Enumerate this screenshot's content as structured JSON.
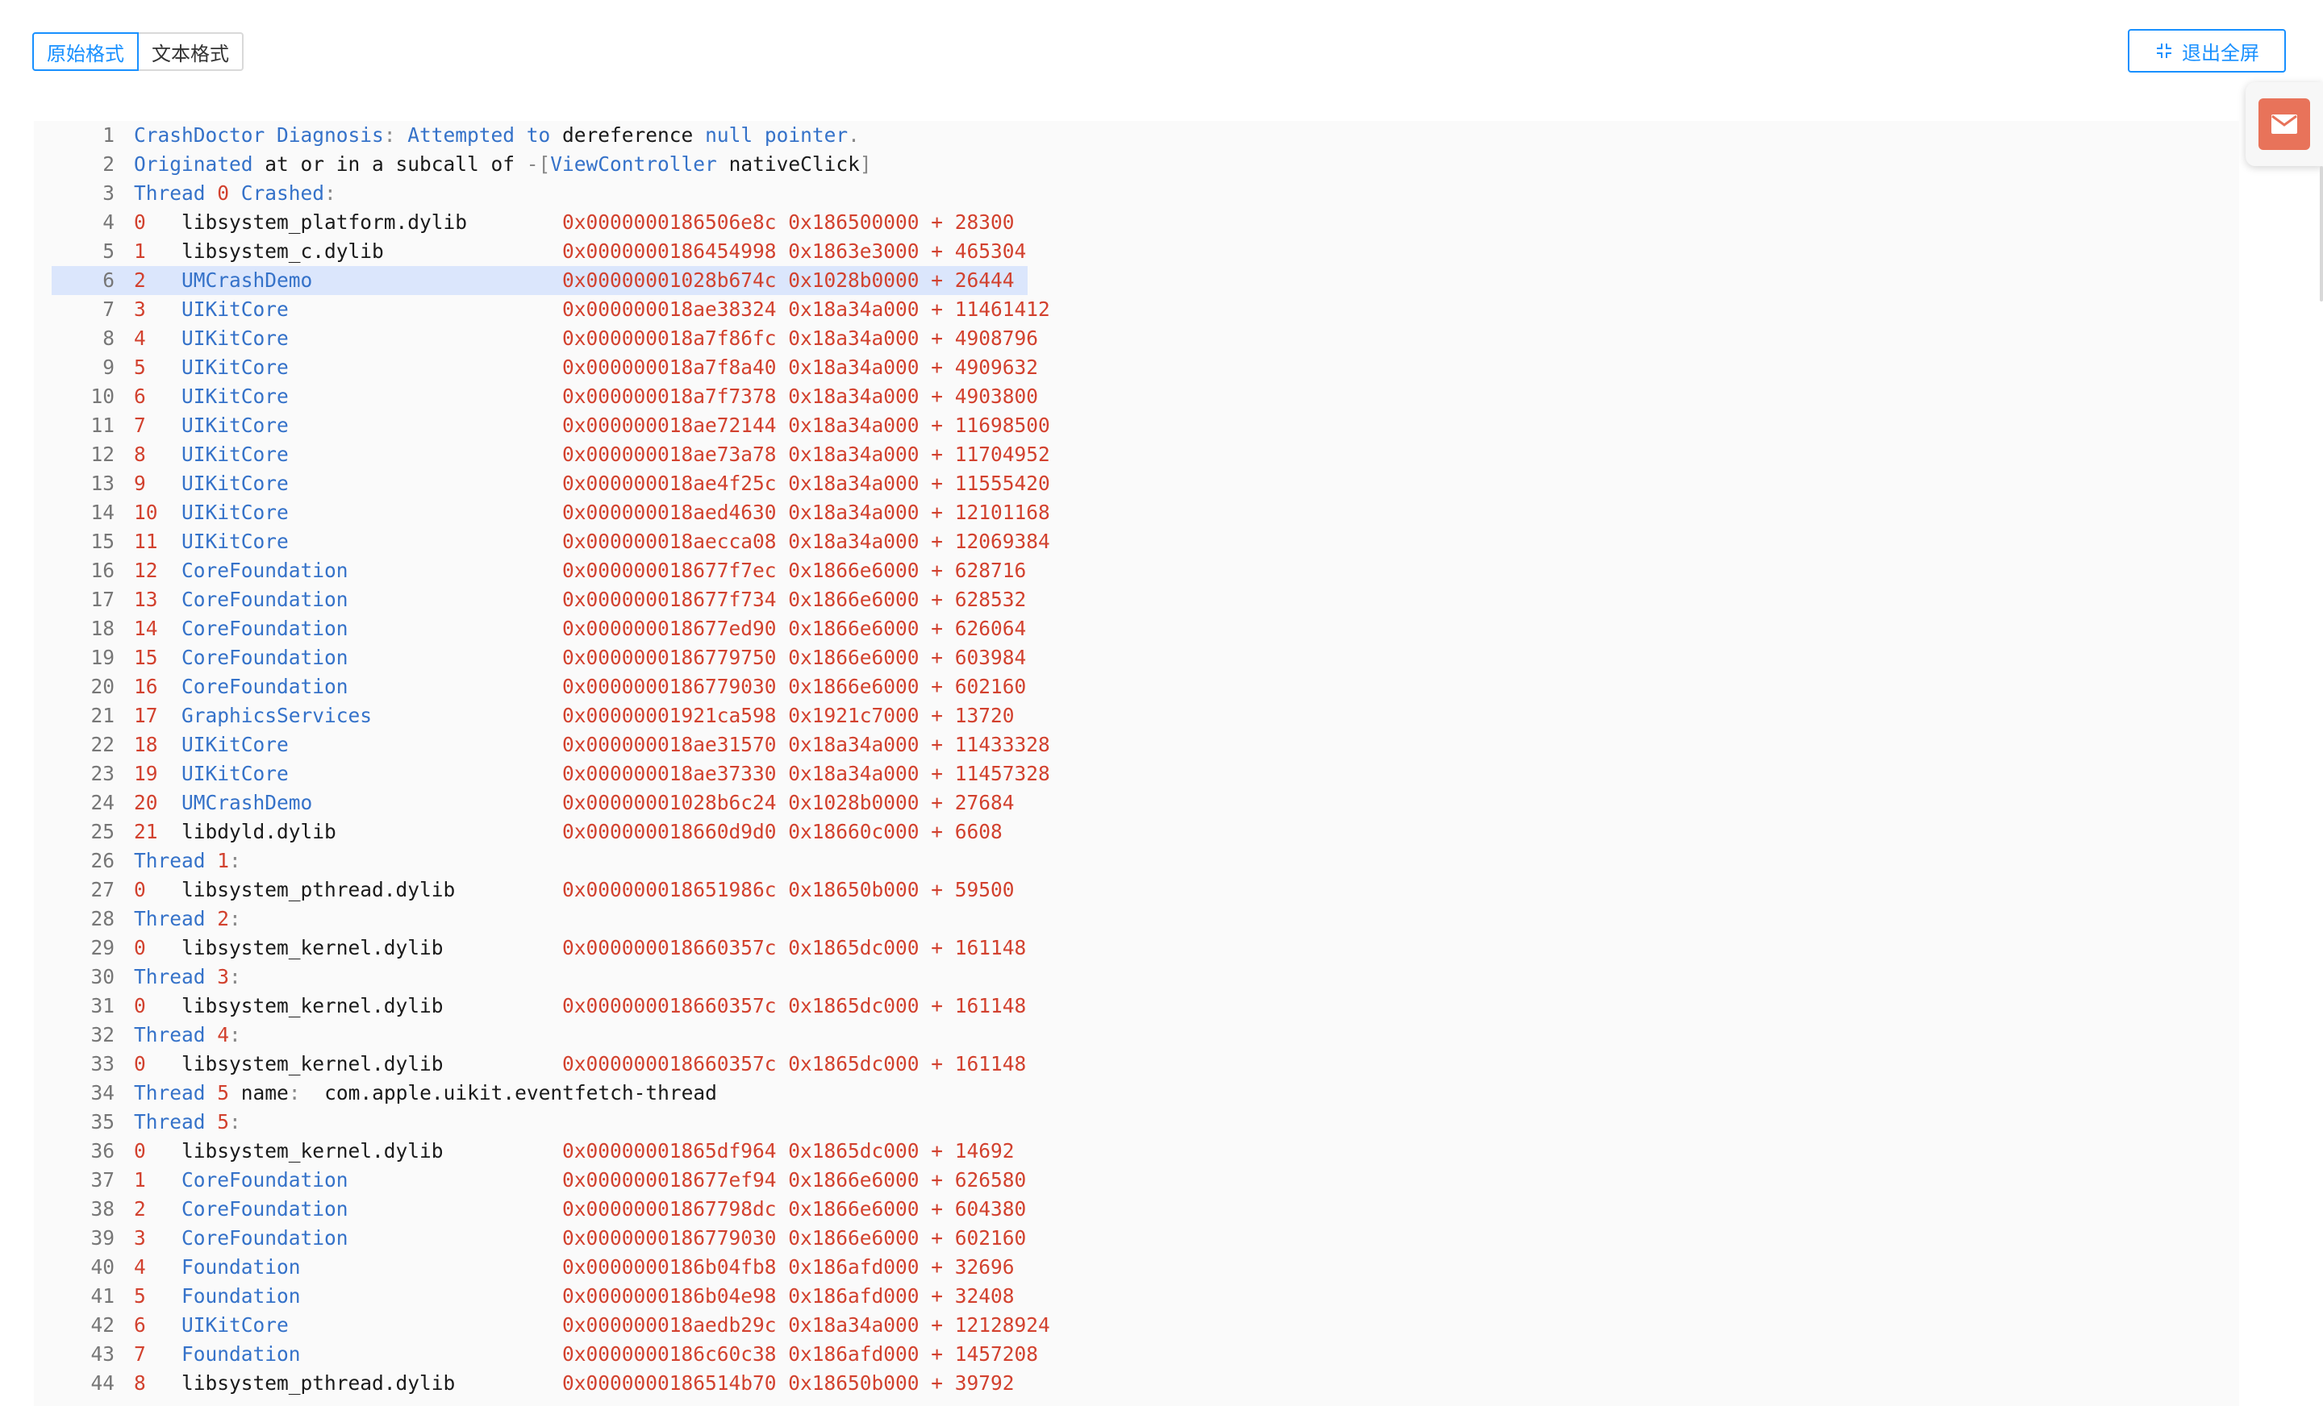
{
  "toolbar": {
    "raw_format_label": "原始格式",
    "text_format_label": "文本格式",
    "exit_fullscreen_label": "退出全屏"
  },
  "colors": {
    "accent": "#1890ff",
    "keyword": "#3572c9",
    "number": "#d2412e",
    "highlight": "#dbe6fc",
    "mail": "#e8735a"
  },
  "icons": {
    "exit": "exit-fullscreen-icon",
    "mail": "mail-icon"
  },
  "highlighted_line": 6,
  "lines": [
    {
      "n": "1",
      "tokens": [
        [
          "k",
          "CrashDoctor Diagnosis"
        ],
        [
          "p",
          ": "
        ],
        [
          "k",
          "Attempted to "
        ],
        [
          "t",
          "dereference "
        ],
        [
          "k",
          "null pointer"
        ],
        [
          "p",
          "."
        ]
      ]
    },
    {
      "n": "2",
      "tokens": [
        [
          "k",
          "Originated "
        ],
        [
          "t",
          "at or in a subcall of "
        ],
        [
          "p",
          "-["
        ],
        [
          "k",
          "ViewController "
        ],
        [
          "t",
          "nativeClick"
        ],
        [
          "p",
          "]"
        ]
      ]
    },
    {
      "n": "3",
      "tokens": [
        [
          "k",
          "Thread "
        ],
        [
          "r",
          "0 "
        ],
        [
          "k",
          "Crashed"
        ],
        [
          "p",
          ":"
        ]
      ]
    },
    {
      "n": "4",
      "tokens": [
        [
          "r",
          "0   "
        ],
        [
          "t",
          "libsystem_platform.dylib        "
        ],
        [
          "r",
          "0x0000000186506e8c 0x186500000 + 28300"
        ]
      ]
    },
    {
      "n": "5",
      "tokens": [
        [
          "r",
          "1   "
        ],
        [
          "t",
          "libsystem_c.dylib               "
        ],
        [
          "r",
          "0x0000000186454998 0x1863e3000 + 465304"
        ]
      ]
    },
    {
      "n": "6",
      "tokens": [
        [
          "r",
          "2   "
        ],
        [
          "k",
          "UMCrashDemo                     "
        ],
        [
          "r",
          "0x00000001028b674c 0x1028b0000 + 26444"
        ]
      ]
    },
    {
      "n": "7",
      "tokens": [
        [
          "r",
          "3   "
        ],
        [
          "k",
          "UIKitCore                       "
        ],
        [
          "r",
          "0x000000018ae38324 0x18a34a000 + 11461412"
        ]
      ]
    },
    {
      "n": "8",
      "tokens": [
        [
          "r",
          "4   "
        ],
        [
          "k",
          "UIKitCore                       "
        ],
        [
          "r",
          "0x000000018a7f86fc 0x18a34a000 + 4908796"
        ]
      ]
    },
    {
      "n": "9",
      "tokens": [
        [
          "r",
          "5   "
        ],
        [
          "k",
          "UIKitCore                       "
        ],
        [
          "r",
          "0x000000018a7f8a40 0x18a34a000 + 4909632"
        ]
      ]
    },
    {
      "n": "10",
      "tokens": [
        [
          "r",
          "6   "
        ],
        [
          "k",
          "UIKitCore                       "
        ],
        [
          "r",
          "0x000000018a7f7378 0x18a34a000 + 4903800"
        ]
      ]
    },
    {
      "n": "11",
      "tokens": [
        [
          "r",
          "7   "
        ],
        [
          "k",
          "UIKitCore                       "
        ],
        [
          "r",
          "0x000000018ae72144 0x18a34a000 + 11698500"
        ]
      ]
    },
    {
      "n": "12",
      "tokens": [
        [
          "r",
          "8   "
        ],
        [
          "k",
          "UIKitCore                       "
        ],
        [
          "r",
          "0x000000018ae73a78 0x18a34a000 + 11704952"
        ]
      ]
    },
    {
      "n": "13",
      "tokens": [
        [
          "r",
          "9   "
        ],
        [
          "k",
          "UIKitCore                       "
        ],
        [
          "r",
          "0x000000018ae4f25c 0x18a34a000 + 11555420"
        ]
      ]
    },
    {
      "n": "14",
      "tokens": [
        [
          "r",
          "10  "
        ],
        [
          "k",
          "UIKitCore                       "
        ],
        [
          "r",
          "0x000000018aed4630 0x18a34a000 + 12101168"
        ]
      ]
    },
    {
      "n": "15",
      "tokens": [
        [
          "r",
          "11  "
        ],
        [
          "k",
          "UIKitCore                       "
        ],
        [
          "r",
          "0x000000018aecca08 0x18a34a000 + 12069384"
        ]
      ]
    },
    {
      "n": "16",
      "tokens": [
        [
          "r",
          "12  "
        ],
        [
          "k",
          "CoreFoundation                  "
        ],
        [
          "r",
          "0x000000018677f7ec 0x1866e6000 + 628716"
        ]
      ]
    },
    {
      "n": "17",
      "tokens": [
        [
          "r",
          "13  "
        ],
        [
          "k",
          "CoreFoundation                  "
        ],
        [
          "r",
          "0x000000018677f734 0x1866e6000 + 628532"
        ]
      ]
    },
    {
      "n": "18",
      "tokens": [
        [
          "r",
          "14  "
        ],
        [
          "k",
          "CoreFoundation                  "
        ],
        [
          "r",
          "0x000000018677ed90 0x1866e6000 + 626064"
        ]
      ]
    },
    {
      "n": "19",
      "tokens": [
        [
          "r",
          "15  "
        ],
        [
          "k",
          "CoreFoundation                  "
        ],
        [
          "r",
          "0x0000000186779750 0x1866e6000 + 603984"
        ]
      ]
    },
    {
      "n": "20",
      "tokens": [
        [
          "r",
          "16  "
        ],
        [
          "k",
          "CoreFoundation                  "
        ],
        [
          "r",
          "0x0000000186779030 0x1866e6000 + 602160"
        ]
      ]
    },
    {
      "n": "21",
      "tokens": [
        [
          "r",
          "17  "
        ],
        [
          "k",
          "GraphicsServices                "
        ],
        [
          "r",
          "0x00000001921ca598 0x1921c7000 + 13720"
        ]
      ]
    },
    {
      "n": "22",
      "tokens": [
        [
          "r",
          "18  "
        ],
        [
          "k",
          "UIKitCore                       "
        ],
        [
          "r",
          "0x000000018ae31570 0x18a34a000 + 11433328"
        ]
      ]
    },
    {
      "n": "23",
      "tokens": [
        [
          "r",
          "19  "
        ],
        [
          "k",
          "UIKitCore                       "
        ],
        [
          "r",
          "0x000000018ae37330 0x18a34a000 + 11457328"
        ]
      ]
    },
    {
      "n": "24",
      "tokens": [
        [
          "r",
          "20  "
        ],
        [
          "k",
          "UMCrashDemo                     "
        ],
        [
          "r",
          "0x00000001028b6c24 0x1028b0000 + 27684"
        ]
      ]
    },
    {
      "n": "25",
      "tokens": [
        [
          "r",
          "21  "
        ],
        [
          "t",
          "libdyld.dylib                   "
        ],
        [
          "r",
          "0x000000018660d9d0 0x18660c000 + 6608"
        ]
      ]
    },
    {
      "n": "26",
      "tokens": [
        [
          "k",
          "Thread "
        ],
        [
          "r",
          "1"
        ],
        [
          "p",
          ":"
        ]
      ]
    },
    {
      "n": "27",
      "tokens": [
        [
          "r",
          "0   "
        ],
        [
          "t",
          "libsystem_pthread.dylib         "
        ],
        [
          "r",
          "0x000000018651986c 0x18650b000 + 59500"
        ]
      ]
    },
    {
      "n": "28",
      "tokens": [
        [
          "k",
          "Thread "
        ],
        [
          "r",
          "2"
        ],
        [
          "p",
          ":"
        ]
      ]
    },
    {
      "n": "29",
      "tokens": [
        [
          "r",
          "0   "
        ],
        [
          "t",
          "libsystem_kernel.dylib          "
        ],
        [
          "r",
          "0x000000018660357c 0x1865dc000 + 161148"
        ]
      ]
    },
    {
      "n": "30",
      "tokens": [
        [
          "k",
          "Thread "
        ],
        [
          "r",
          "3"
        ],
        [
          "p",
          ":"
        ]
      ]
    },
    {
      "n": "31",
      "tokens": [
        [
          "r",
          "0   "
        ],
        [
          "t",
          "libsystem_kernel.dylib          "
        ],
        [
          "r",
          "0x000000018660357c 0x1865dc000 + 161148"
        ]
      ]
    },
    {
      "n": "32",
      "tokens": [
        [
          "k",
          "Thread "
        ],
        [
          "r",
          "4"
        ],
        [
          "p",
          ":"
        ]
      ]
    },
    {
      "n": "33",
      "tokens": [
        [
          "r",
          "0   "
        ],
        [
          "t",
          "libsystem_kernel.dylib          "
        ],
        [
          "r",
          "0x000000018660357c 0x1865dc000 + 161148"
        ]
      ]
    },
    {
      "n": "34",
      "tokens": [
        [
          "k",
          "Thread "
        ],
        [
          "r",
          "5 "
        ],
        [
          "t",
          "name"
        ],
        [
          "p",
          ":  "
        ],
        [
          "t",
          "com.apple.uikit.eventfetch-thread"
        ]
      ]
    },
    {
      "n": "35",
      "tokens": [
        [
          "k",
          "Thread "
        ],
        [
          "r",
          "5"
        ],
        [
          "p",
          ":"
        ]
      ]
    },
    {
      "n": "36",
      "tokens": [
        [
          "r",
          "0   "
        ],
        [
          "t",
          "libsystem_kernel.dylib          "
        ],
        [
          "r",
          "0x00000001865df964 0x1865dc000 + 14692"
        ]
      ]
    },
    {
      "n": "37",
      "tokens": [
        [
          "r",
          "1   "
        ],
        [
          "k",
          "CoreFoundation                  "
        ],
        [
          "r",
          "0x000000018677ef94 0x1866e6000 + 626580"
        ]
      ]
    },
    {
      "n": "38",
      "tokens": [
        [
          "r",
          "2   "
        ],
        [
          "k",
          "CoreFoundation                  "
        ],
        [
          "r",
          "0x00000001867798dc 0x1866e6000 + 604380"
        ]
      ]
    },
    {
      "n": "39",
      "tokens": [
        [
          "r",
          "3   "
        ],
        [
          "k",
          "CoreFoundation                  "
        ],
        [
          "r",
          "0x0000000186779030 0x1866e6000 + 602160"
        ]
      ]
    },
    {
      "n": "40",
      "tokens": [
        [
          "r",
          "4   "
        ],
        [
          "k",
          "Foundation                      "
        ],
        [
          "r",
          "0x0000000186b04fb8 0x186afd000 + 32696"
        ]
      ]
    },
    {
      "n": "41",
      "tokens": [
        [
          "r",
          "5   "
        ],
        [
          "k",
          "Foundation                      "
        ],
        [
          "r",
          "0x0000000186b04e98 0x186afd000 + 32408"
        ]
      ]
    },
    {
      "n": "42",
      "tokens": [
        [
          "r",
          "6   "
        ],
        [
          "k",
          "UIKitCore                       "
        ],
        [
          "r",
          "0x000000018aedb29c 0x18a34a000 + 12128924"
        ]
      ]
    },
    {
      "n": "43",
      "tokens": [
        [
          "r",
          "7   "
        ],
        [
          "k",
          "Foundation                      "
        ],
        [
          "r",
          "0x0000000186c60c38 0x186afd000 + 1457208"
        ]
      ]
    },
    {
      "n": "44",
      "tokens": [
        [
          "r",
          "8   "
        ],
        [
          "t",
          "libsystem_pthread.dylib         "
        ],
        [
          "r",
          "0x0000000186514b70 0x18650b000 + 39792"
        ]
      ]
    }
  ]
}
